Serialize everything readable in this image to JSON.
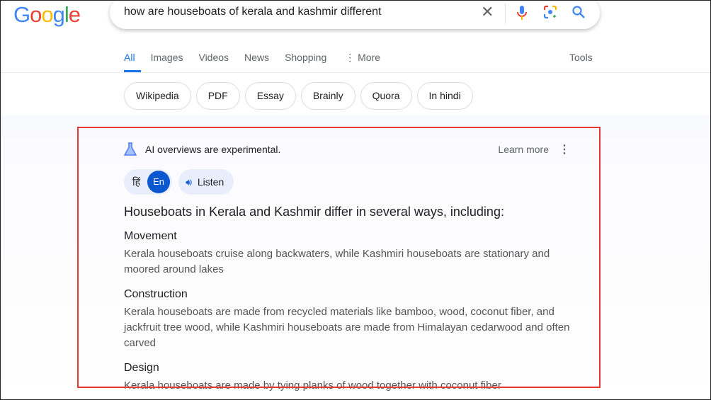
{
  "logo": "Google",
  "search": {
    "query": "how are houseboats of kerala and kashmir different"
  },
  "tabs": [
    "All",
    "Images",
    "Videos",
    "News",
    "Shopping",
    "More"
  ],
  "tools": "Tools",
  "chips": [
    "Wikipedia",
    "PDF",
    "Essay",
    "Brainly",
    "Quora",
    "In hindi"
  ],
  "ai": {
    "notice": "AI overviews are experimental.",
    "learn_more": "Learn more",
    "lang_hi": "हिं",
    "lang_en": "En",
    "listen": "Listen",
    "intro": "Houseboats in Kerala and Kashmir differ in several ways, including:",
    "sections": [
      {
        "title": "Movement",
        "text": "Kerala houseboats cruise along backwaters, while Kashmiri houseboats are stationary and moored around lakes"
      },
      {
        "title": "Construction",
        "text": "Kerala houseboats are made from recycled materials like bamboo, wood, coconut fiber, and jackfruit tree wood, while Kashmiri houseboats are made from Himalayan cedarwood and often carved"
      },
      {
        "title": "Design",
        "text": "Kerala houseboats are made by tying planks of wood together with coconut fiber"
      }
    ]
  }
}
